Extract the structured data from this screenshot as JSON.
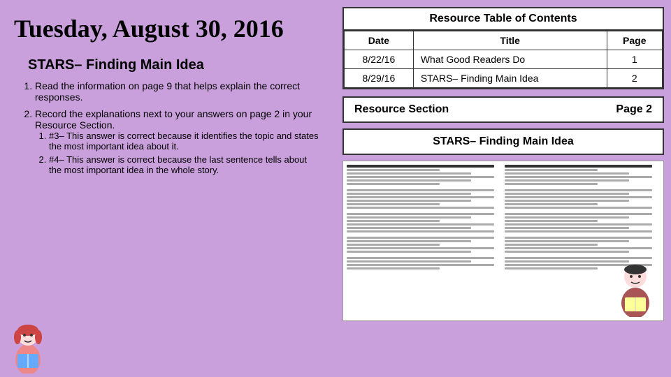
{
  "left": {
    "date": "Tuesday, August 30, 2016",
    "topic": "STARS– Finding Main Idea",
    "instructions": [
      {
        "text": "Read the information on page 9 that helps explain the correct responses.",
        "sub": []
      },
      {
        "text": "Record the explanations next to your answers on page 2 in your Resource Section.",
        "sub": [
          "#3– This answer is correct because it identifies the topic and states the most important idea about it.",
          "#4– This answer is correct because the last sentence tells about the most important idea in the whole story."
        ]
      }
    ]
  },
  "right": {
    "toc": {
      "title": "Resource Table of Contents",
      "headers": [
        "Date",
        "Title",
        "Page"
      ],
      "rows": [
        {
          "date": "8/22/16",
          "title": "What Good Readers Do",
          "page": "1"
        },
        {
          "date": "8/29/16",
          "title": "STARS– Finding Main Idea",
          "page": "2"
        }
      ]
    },
    "resource_section": {
      "label": "Resource Section",
      "page_label": "Page 2"
    },
    "stars_heading": "STARS– Finding Main Idea"
  }
}
